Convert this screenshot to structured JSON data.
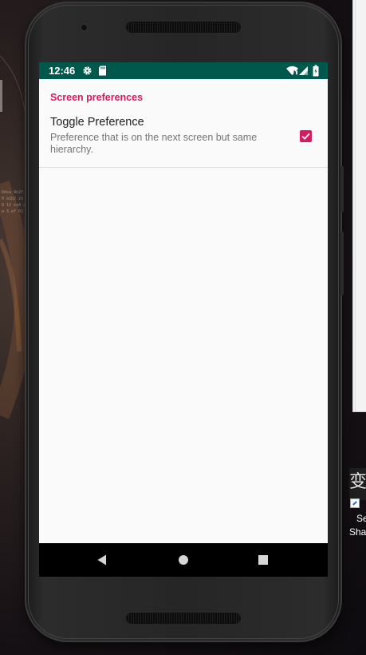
{
  "status_bar": {
    "time": "12:46",
    "left_icons": [
      "gear-icon",
      "sd-card-icon"
    ],
    "right_icons": [
      "wifi-icon",
      "cell-signal-icon",
      "battery-icon"
    ],
    "background": "#00574b"
  },
  "preferences": {
    "category_title": "Screen preferences",
    "items": [
      {
        "title": "Toggle Preference",
        "summary": "Preference that is on the next screen but same hierarchy.",
        "checked": true
      }
    ],
    "accent_color": "#d81b60"
  },
  "nav_bar": {
    "buttons": [
      "back-icon",
      "home-icon",
      "recents-icon"
    ]
  },
  "desktop": {
    "shortcut_label_line1": "Se",
    "shortcut_label_line2": "Sha",
    "shortcut_glyph": "变"
  }
}
